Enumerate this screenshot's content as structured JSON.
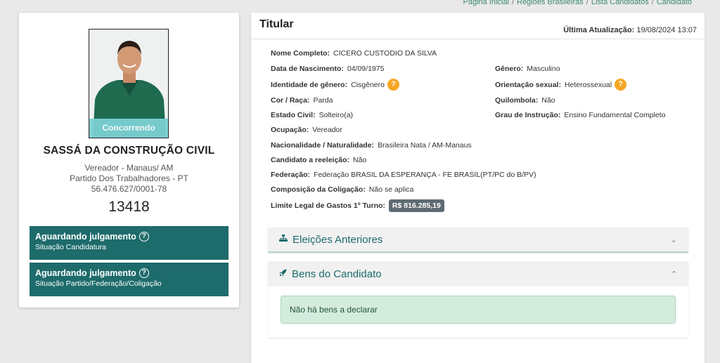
{
  "breadcrumb": [
    "Página Inicial",
    "Regiões Brasileiras",
    "Lista Candidatos",
    "Candidato"
  ],
  "candidate": {
    "status_badge": "Concorrendo",
    "name": "SASSÁ DA CONSTRUÇÃO CIVIL",
    "office": "Vereador - Manaus/ AM",
    "party": "Partido Dos Trabalhadores - PT",
    "cnpj": "56.476.627/0001-78",
    "number": "13418"
  },
  "status_boxes": [
    {
      "title": "Aguardando julgamento",
      "subtitle": "Situação Candidatura"
    },
    {
      "title": "Aguardando julgamento",
      "subtitle": "Situação Partido/Federação/Coligação"
    }
  ],
  "panel": {
    "title": "Titular",
    "last_update_label": "Última Atualização:",
    "last_update_value": "19/08/2024 13:07"
  },
  "fields": {
    "nome_completo": {
      "label": "Nome Completo:",
      "value": "CICERO CUSTODIO DA SILVA"
    },
    "data_nascimento": {
      "label": "Data de Nascimento:",
      "value": "04/09/1975"
    },
    "genero": {
      "label": "Gênero:",
      "value": "Masculino"
    },
    "identidade_genero": {
      "label": "Identidade de gênero:",
      "value": "Cisgênero"
    },
    "orientacao_sexual": {
      "label": "Orientação sexual:",
      "value": "Heterossexual"
    },
    "cor_raca": {
      "label": "Cor / Raça:",
      "value": "Parda"
    },
    "quilombola": {
      "label": "Quilombola:",
      "value": "Não"
    },
    "estado_civil": {
      "label": "Estado Civil:",
      "value": "Solteiro(a)"
    },
    "grau_instrucao": {
      "label": "Grau de Instrução:",
      "value": "Ensino Fundamental Completo"
    },
    "ocupacao": {
      "label": "Ocupação:",
      "value": "Vereador"
    },
    "nacionalidade": {
      "label": "Nacionalidade / Naturalidade:",
      "value": "Brasileira Nata / AM-Manaus"
    },
    "reeleicao": {
      "label": "Candidato a reeleição:",
      "value": "Não"
    },
    "federacao": {
      "label": "Federação:",
      "value": "Federação BRASIL DA ESPERANÇA - FE BRASIL(PT/PC do B/PV)"
    },
    "coligacao": {
      "label": "Composição da Coligação:",
      "value": "Não se aplica"
    },
    "limite_gastos": {
      "label": "Limite Legal de Gastos 1º Turno:",
      "value": "R$ 816.285,19"
    }
  },
  "help_glyph": "?",
  "accordions": {
    "eleicoes": {
      "label": "Eleições Anteriores",
      "icon": "sitemap-icon"
    },
    "bens": {
      "label": "Bens do Candidato",
      "icon": "rocket-icon",
      "message": "Não há bens a declarar"
    }
  },
  "colors": {
    "primary": "#1e6b6b",
    "accent_green": "#3a8a68",
    "badge": "#7ad0d2",
    "help_orange": "#f5a623"
  }
}
